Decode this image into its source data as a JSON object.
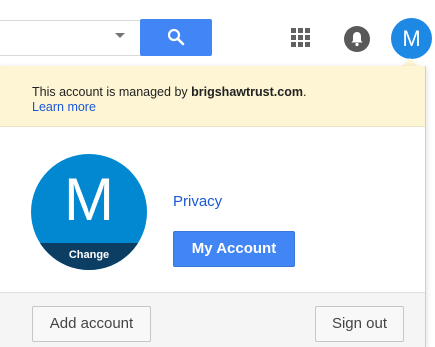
{
  "header": {
    "search_icon": "search-icon",
    "apps_icon": "apps-grid-icon",
    "notifications_icon": "bell-icon",
    "avatar_letter": "M"
  },
  "account_popup": {
    "notice_text": "This account is managed by ",
    "notice_domain": "brigshawtrust.com",
    "notice_suffix": ".",
    "learn_more": "Learn more",
    "avatar_letter": "M",
    "avatar_change": "Change",
    "privacy_link": "Privacy",
    "my_account_button": "My Account",
    "add_account_button": "Add account",
    "sign_out_button": "Sign out"
  },
  "colors": {
    "accent": "#4285f4",
    "notice_bg": "#fdf5d4",
    "avatar_bg": "#0288d1",
    "avatar_change_bg": "#0c3e63",
    "link": "#1a58d6"
  }
}
